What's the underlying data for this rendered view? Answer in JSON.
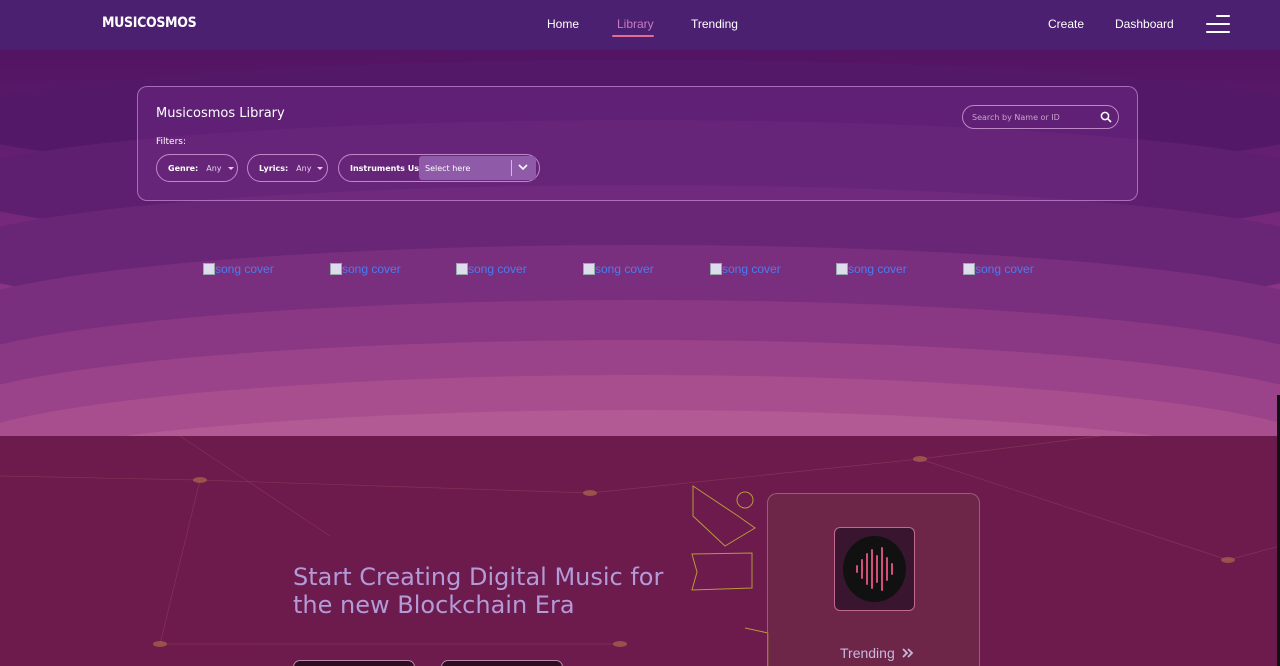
{
  "nav": {
    "logo": "MUSICOSMOS",
    "links": [
      "Home",
      "Library",
      "Trending"
    ],
    "right_links": [
      "Create",
      "Dashboard"
    ],
    "active": "Library"
  },
  "library": {
    "title": "Musicosmos Library",
    "filters_label": "Filters:",
    "genre": {
      "label": "Genre:",
      "value": "Any"
    },
    "lyrics": {
      "label": "Lyrics:",
      "value": "Any"
    },
    "instruments": {
      "label": "Instruments Used:",
      "value": "Select here"
    },
    "search_placeholder": "Search by Name or ID"
  },
  "covers": [
    "song cover",
    "song cover",
    "song cover",
    "song cover",
    "song cover",
    "song cover",
    "song cover"
  ],
  "hero": {
    "title_line1": "Start Creating Digital Music for",
    "title_line2": "the new Blockchain Era",
    "card_label": "Trending"
  },
  "colors": {
    "accent": "#e86a8e",
    "active_link": "#c77bc0",
    "hero_title": "#b39ad8"
  }
}
